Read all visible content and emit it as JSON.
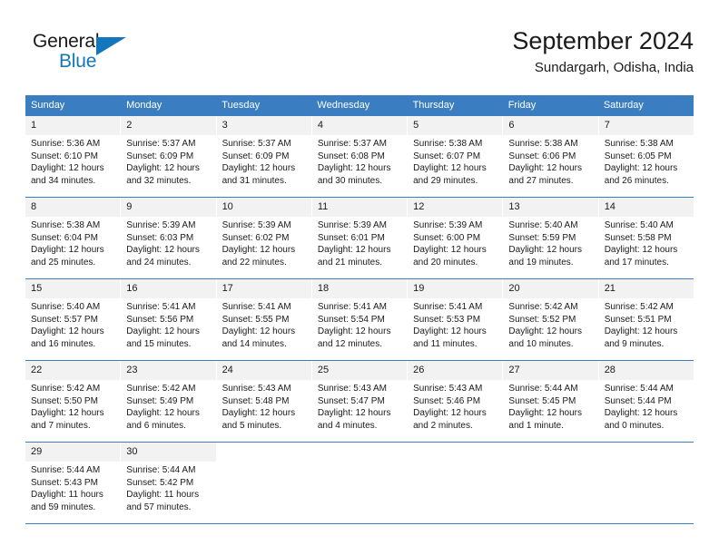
{
  "brand": {
    "name_top": "General",
    "name_bottom": "Blue",
    "triangle_color": "#1277bc",
    "text_color": "#1a1a1a"
  },
  "header": {
    "title": "September 2024",
    "subtitle": "Sundargarh, Odisha, India"
  },
  "theme": {
    "header_bg": "#3a7dc0",
    "header_text": "#ffffff",
    "daynum_bg": "#f2f2f2",
    "cell_bg": "#ffffff",
    "body_text": "#1a1a1a"
  },
  "weekdays": [
    "Sunday",
    "Monday",
    "Tuesday",
    "Wednesday",
    "Thursday",
    "Friday",
    "Saturday"
  ],
  "weeks": [
    [
      {
        "day": "1",
        "sunrise": "Sunrise: 5:36 AM",
        "sunset": "Sunset: 6:10 PM",
        "daylight_line1": "Daylight: 12 hours",
        "daylight_line2": "and 34 minutes."
      },
      {
        "day": "2",
        "sunrise": "Sunrise: 5:37 AM",
        "sunset": "Sunset: 6:09 PM",
        "daylight_line1": "Daylight: 12 hours",
        "daylight_line2": "and 32 minutes."
      },
      {
        "day": "3",
        "sunrise": "Sunrise: 5:37 AM",
        "sunset": "Sunset: 6:09 PM",
        "daylight_line1": "Daylight: 12 hours",
        "daylight_line2": "and 31 minutes."
      },
      {
        "day": "4",
        "sunrise": "Sunrise: 5:37 AM",
        "sunset": "Sunset: 6:08 PM",
        "daylight_line1": "Daylight: 12 hours",
        "daylight_line2": "and 30 minutes."
      },
      {
        "day": "5",
        "sunrise": "Sunrise: 5:38 AM",
        "sunset": "Sunset: 6:07 PM",
        "daylight_line1": "Daylight: 12 hours",
        "daylight_line2": "and 29 minutes."
      },
      {
        "day": "6",
        "sunrise": "Sunrise: 5:38 AM",
        "sunset": "Sunset: 6:06 PM",
        "daylight_line1": "Daylight: 12 hours",
        "daylight_line2": "and 27 minutes."
      },
      {
        "day": "7",
        "sunrise": "Sunrise: 5:38 AM",
        "sunset": "Sunset: 6:05 PM",
        "daylight_line1": "Daylight: 12 hours",
        "daylight_line2": "and 26 minutes."
      }
    ],
    [
      {
        "day": "8",
        "sunrise": "Sunrise: 5:38 AM",
        "sunset": "Sunset: 6:04 PM",
        "daylight_line1": "Daylight: 12 hours",
        "daylight_line2": "and 25 minutes."
      },
      {
        "day": "9",
        "sunrise": "Sunrise: 5:39 AM",
        "sunset": "Sunset: 6:03 PM",
        "daylight_line1": "Daylight: 12 hours",
        "daylight_line2": "and 24 minutes."
      },
      {
        "day": "10",
        "sunrise": "Sunrise: 5:39 AM",
        "sunset": "Sunset: 6:02 PM",
        "daylight_line1": "Daylight: 12 hours",
        "daylight_line2": "and 22 minutes."
      },
      {
        "day": "11",
        "sunrise": "Sunrise: 5:39 AM",
        "sunset": "Sunset: 6:01 PM",
        "daylight_line1": "Daylight: 12 hours",
        "daylight_line2": "and 21 minutes."
      },
      {
        "day": "12",
        "sunrise": "Sunrise: 5:39 AM",
        "sunset": "Sunset: 6:00 PM",
        "daylight_line1": "Daylight: 12 hours",
        "daylight_line2": "and 20 minutes."
      },
      {
        "day": "13",
        "sunrise": "Sunrise: 5:40 AM",
        "sunset": "Sunset: 5:59 PM",
        "daylight_line1": "Daylight: 12 hours",
        "daylight_line2": "and 19 minutes."
      },
      {
        "day": "14",
        "sunrise": "Sunrise: 5:40 AM",
        "sunset": "Sunset: 5:58 PM",
        "daylight_line1": "Daylight: 12 hours",
        "daylight_line2": "and 17 minutes."
      }
    ],
    [
      {
        "day": "15",
        "sunrise": "Sunrise: 5:40 AM",
        "sunset": "Sunset: 5:57 PM",
        "daylight_line1": "Daylight: 12 hours",
        "daylight_line2": "and 16 minutes."
      },
      {
        "day": "16",
        "sunrise": "Sunrise: 5:41 AM",
        "sunset": "Sunset: 5:56 PM",
        "daylight_line1": "Daylight: 12 hours",
        "daylight_line2": "and 15 minutes."
      },
      {
        "day": "17",
        "sunrise": "Sunrise: 5:41 AM",
        "sunset": "Sunset: 5:55 PM",
        "daylight_line1": "Daylight: 12 hours",
        "daylight_line2": "and 14 minutes."
      },
      {
        "day": "18",
        "sunrise": "Sunrise: 5:41 AM",
        "sunset": "Sunset: 5:54 PM",
        "daylight_line1": "Daylight: 12 hours",
        "daylight_line2": "and 12 minutes."
      },
      {
        "day": "19",
        "sunrise": "Sunrise: 5:41 AM",
        "sunset": "Sunset: 5:53 PM",
        "daylight_line1": "Daylight: 12 hours",
        "daylight_line2": "and 11 minutes."
      },
      {
        "day": "20",
        "sunrise": "Sunrise: 5:42 AM",
        "sunset": "Sunset: 5:52 PM",
        "daylight_line1": "Daylight: 12 hours",
        "daylight_line2": "and 10 minutes."
      },
      {
        "day": "21",
        "sunrise": "Sunrise: 5:42 AM",
        "sunset": "Sunset: 5:51 PM",
        "daylight_line1": "Daylight: 12 hours",
        "daylight_line2": "and 9 minutes."
      }
    ],
    [
      {
        "day": "22",
        "sunrise": "Sunrise: 5:42 AM",
        "sunset": "Sunset: 5:50 PM",
        "daylight_line1": "Daylight: 12 hours",
        "daylight_line2": "and 7 minutes."
      },
      {
        "day": "23",
        "sunrise": "Sunrise: 5:42 AM",
        "sunset": "Sunset: 5:49 PM",
        "daylight_line1": "Daylight: 12 hours",
        "daylight_line2": "and 6 minutes."
      },
      {
        "day": "24",
        "sunrise": "Sunrise: 5:43 AM",
        "sunset": "Sunset: 5:48 PM",
        "daylight_line1": "Daylight: 12 hours",
        "daylight_line2": "and 5 minutes."
      },
      {
        "day": "25",
        "sunrise": "Sunrise: 5:43 AM",
        "sunset": "Sunset: 5:47 PM",
        "daylight_line1": "Daylight: 12 hours",
        "daylight_line2": "and 4 minutes."
      },
      {
        "day": "26",
        "sunrise": "Sunrise: 5:43 AM",
        "sunset": "Sunset: 5:46 PM",
        "daylight_line1": "Daylight: 12 hours",
        "daylight_line2": "and 2 minutes."
      },
      {
        "day": "27",
        "sunrise": "Sunrise: 5:44 AM",
        "sunset": "Sunset: 5:45 PM",
        "daylight_line1": "Daylight: 12 hours",
        "daylight_line2": "and 1 minute."
      },
      {
        "day": "28",
        "sunrise": "Sunrise: 5:44 AM",
        "sunset": "Sunset: 5:44 PM",
        "daylight_line1": "Daylight: 12 hours",
        "daylight_line2": "and 0 minutes."
      }
    ],
    [
      {
        "day": "29",
        "sunrise": "Sunrise: 5:44 AM",
        "sunset": "Sunset: 5:43 PM",
        "daylight_line1": "Daylight: 11 hours",
        "daylight_line2": "and 59 minutes."
      },
      {
        "day": "30",
        "sunrise": "Sunrise: 5:44 AM",
        "sunset": "Sunset: 5:42 PM",
        "daylight_line1": "Daylight: 11 hours",
        "daylight_line2": "and 57 minutes."
      },
      {
        "day": "",
        "sunrise": "",
        "sunset": "",
        "daylight_line1": "",
        "daylight_line2": ""
      },
      {
        "day": "",
        "sunrise": "",
        "sunset": "",
        "daylight_line1": "",
        "daylight_line2": ""
      },
      {
        "day": "",
        "sunrise": "",
        "sunset": "",
        "daylight_line1": "",
        "daylight_line2": ""
      },
      {
        "day": "",
        "sunrise": "",
        "sunset": "",
        "daylight_line1": "",
        "daylight_line2": ""
      },
      {
        "day": "",
        "sunrise": "",
        "sunset": "",
        "daylight_line1": "",
        "daylight_line2": ""
      }
    ]
  ]
}
